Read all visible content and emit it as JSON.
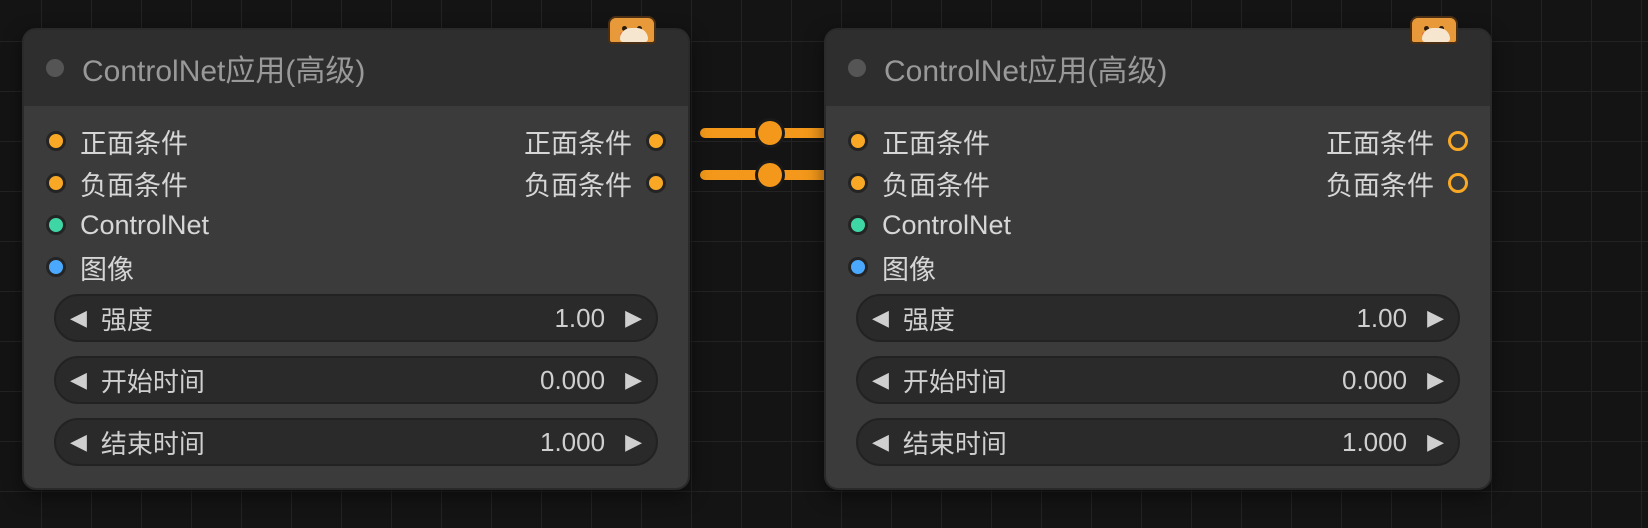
{
  "nodes": [
    {
      "title": "ControlNet应用(高级)",
      "inputs": {
        "positive": "正面条件",
        "negative": "负面条件",
        "controlnet": "ControlNet",
        "image": "图像"
      },
      "outputs": {
        "positive": "正面条件",
        "negative": "负面条件"
      },
      "widgets": {
        "strength": {
          "label": "强度",
          "value": "1.00"
        },
        "start": {
          "label": "开始时间",
          "value": "0.000"
        },
        "end": {
          "label": "结束时间",
          "value": "1.000"
        }
      }
    },
    {
      "title": "ControlNet应用(高级)",
      "inputs": {
        "positive": "正面条件",
        "negative": "负面条件",
        "controlnet": "ControlNet",
        "image": "图像"
      },
      "outputs": {
        "positive": "正面条件",
        "negative": "负面条件"
      },
      "widgets": {
        "strength": {
          "label": "强度",
          "value": "1.00"
        },
        "start": {
          "label": "开始时间",
          "value": "0.000"
        },
        "end": {
          "label": "结束时间",
          "value": "1.000"
        }
      }
    }
  ],
  "colors": {
    "conditioning": "#f9a825",
    "controlnet": "#3fd6a6",
    "image": "#4aa8ff"
  }
}
